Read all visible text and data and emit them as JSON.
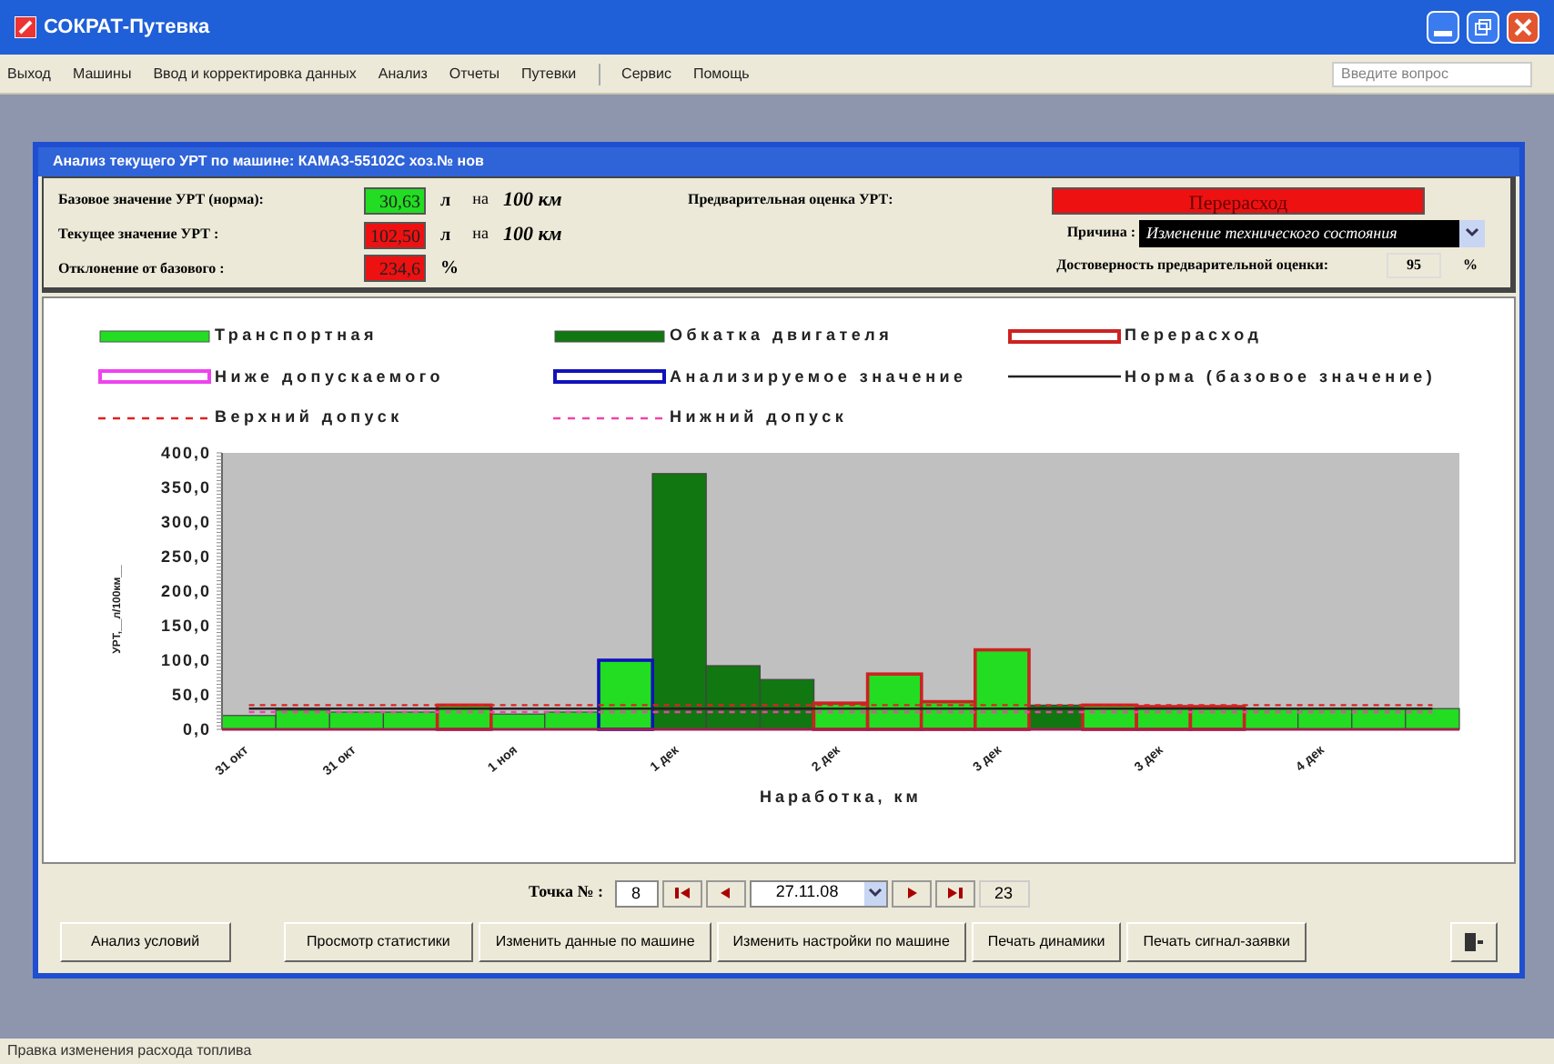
{
  "window": {
    "title": "СОКРАТ-Путевка"
  },
  "menu": [
    "Выход",
    "Машины",
    "Ввод и корректировка данных",
    "Анализ",
    "Отчеты",
    "Путевки",
    "Сервис",
    "Помощь"
  ],
  "help_search": {
    "placeholder": "Введите вопрос"
  },
  "form": {
    "title": "Анализ текущего УРТ по машине: КАМАЗ-55102С хоз.№ нов",
    "fields": [
      {
        "label": "Базовое значение УРТ (норма):",
        "value": "30,63",
        "color": "#22dd22",
        "unit": "л",
        "per": "на",
        "distance": "100 км"
      },
      {
        "label": "Текущее значение УРТ :",
        "value": "102,50",
        "color": "#ee1111",
        "unit": "л",
        "per": "на",
        "distance": "100 км"
      },
      {
        "label": "Отклонение от базового :",
        "value": "234,6",
        "color": "#ee1111",
        "unit": "%"
      }
    ],
    "estimate": {
      "label": "Предварительная оценка УРТ:",
      "value": "Перерасход",
      "color": "#ee1111"
    },
    "reason": {
      "label": "Причина :",
      "value": "Изменение технического состояния"
    },
    "reliability": {
      "label": "Достоверность предварительной оценки:",
      "value": "95",
      "unit": "%"
    },
    "chart_data": {
      "type": "bar",
      "xlabel": "Наработка, км",
      "ylabel": "УРТ,__л/100км__",
      "categories": [
        "31 окт",
        null,
        "31 окт",
        null,
        null,
        "1 ноя",
        null,
        null,
        "1 дек",
        null,
        null,
        "2 дек",
        null,
        null,
        "3 дек",
        null,
        null,
        "3 дек",
        null,
        null,
        "4 дек",
        null,
        null
      ],
      "ylim": [
        0,
        400
      ],
      "yticks": [
        {
          "value": 0,
          "label": "0,0"
        },
        {
          "value": 50,
          "label": "50,0"
        },
        {
          "value": 100,
          "label": "100,0"
        },
        {
          "value": 150,
          "label": "150,0"
        },
        {
          "value": 200,
          "label": "200,0"
        },
        {
          "value": 250,
          "label": "250,0"
        },
        {
          "value": 300,
          "label": "300,0"
        },
        {
          "value": 350,
          "label": "350,0"
        },
        {
          "value": 400,
          "label": "400,0"
        }
      ],
      "series": [
        {
          "name": "Транспортная",
          "type": "bar",
          "color": "#22dd22",
          "values": [
            20,
            28,
            25,
            25,
            null,
            22,
            25,
            null,
            null,
            null,
            null,
            null,
            null,
            null,
            null,
            null,
            null,
            null,
            null,
            30,
            30,
            30,
            30
          ]
        },
        {
          "name": "Обкатка двигателя",
          "type": "bar",
          "color": "#117711",
          "values": [
            null,
            null,
            null,
            null,
            null,
            null,
            null,
            null,
            370,
            92,
            72,
            null,
            null,
            null,
            null,
            35,
            null,
            null,
            null,
            null,
            null,
            null,
            null
          ]
        },
        {
          "name": "Перерасход",
          "type": "bar",
          "color": "#cc2222",
          "values": [
            null,
            null,
            null,
            null,
            35,
            null,
            null,
            null,
            null,
            null,
            null,
            38,
            80,
            40,
            115,
            null,
            35,
            33,
            33,
            null,
            null,
            null,
            null
          ]
        },
        {
          "name": "Ниже допускаемого",
          "type": "bar",
          "color": "#ee44ee",
          "values": [
            null,
            null,
            null,
            null,
            null,
            null,
            null,
            null,
            null,
            null,
            null,
            null,
            null,
            null,
            null,
            null,
            null,
            null,
            null,
            null,
            null,
            null,
            null
          ]
        },
        {
          "name": "Анализируемое значение",
          "type": "bar",
          "color": "#1111bb",
          "values": [
            null,
            null,
            null,
            null,
            null,
            null,
            null,
            100,
            null,
            null,
            null,
            null,
            null,
            null,
            null,
            null,
            null,
            null,
            null,
            null,
            null,
            null,
            null
          ]
        },
        {
          "name": "Норма (базовое значение)",
          "type": "line",
          "color": "#222222",
          "line_style": "solid",
          "values": [
            30,
            30,
            30,
            30,
            30,
            30,
            30,
            30,
            30,
            30,
            30,
            30,
            30,
            30,
            30,
            30,
            30,
            30,
            30,
            30,
            30,
            30,
            30
          ]
        },
        {
          "name": "Верхний допуск",
          "type": "line",
          "color": "#dd2222",
          "line_style": "dashed",
          "values": [
            35,
            35,
            35,
            35,
            35,
            35,
            35,
            35,
            35,
            35,
            35,
            35,
            35,
            35,
            35,
            35,
            35,
            35,
            35,
            35,
            35,
            35,
            35
          ]
        },
        {
          "name": "Нижний допуск",
          "type": "line",
          "color": "#ee44aa",
          "line_style": "dashed",
          "values": [
            25,
            25,
            25,
            25,
            25,
            25,
            25,
            25,
            25,
            25,
            25,
            25,
            25,
            25,
            25,
            25,
            25,
            25,
            25,
            25,
            25,
            25,
            25
          ]
        }
      ]
    },
    "navigation": {
      "label": "Точка № :",
      "point": "8",
      "date": "27.11.08",
      "total": "23"
    },
    "buttons": [
      "Анализ условий",
      "Просмотр статистики",
      "Изменить  данные по машине",
      "Изменить настройки по машине",
      "Печать динамики",
      "Печать сигнал-заявки"
    ]
  },
  "status_bar": "Правка изменения расхода топлива"
}
